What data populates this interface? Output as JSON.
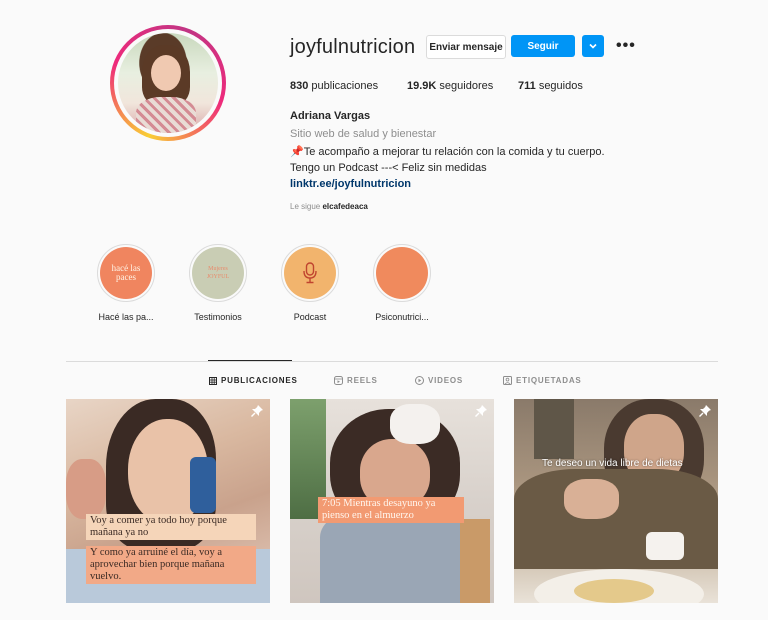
{
  "profile": {
    "username": "joyfulnutricion",
    "message_button": "Enviar mensaje",
    "follow_button": "Seguir",
    "stats": {
      "posts_count": "830",
      "posts_label": "publicaciones",
      "followers_count": "19.9K",
      "followers_label": "seguidores",
      "following_count": "711",
      "following_label": "seguidos"
    },
    "full_name": "Adriana Vargas",
    "category": "Sitio web de salud y bienestar",
    "bio_line1": "📌Te acompaño a mejorar tu relación con la comida y tu cuerpo.",
    "bio_line2": "Tengo un Podcast ---< Feliz sin medidas",
    "link": "linktr.ee/joyfulnutricion",
    "followed_by_prefix": "Le sigue",
    "followed_by_user": "elcafedeaca"
  },
  "highlights": [
    {
      "label": "Hacé las pa...",
      "cover_text": "hacé las paces",
      "color": "#f0855f"
    },
    {
      "label": "Testimonios",
      "cover_text": "Mujeres JOYFUL",
      "color": "#c9cdb4"
    },
    {
      "label": "Podcast",
      "cover_text": "",
      "color": "#f2b46d"
    },
    {
      "label": "Psiconutrici...",
      "cover_text": "",
      "color": "#f08a5d"
    }
  ],
  "tabs": [
    {
      "label": "PUBLICACIONES",
      "icon": "grid-icon",
      "active": true
    },
    {
      "label": "REELS",
      "icon": "reels-icon",
      "active": false
    },
    {
      "label": "VIDEOS",
      "icon": "video-icon",
      "active": false
    },
    {
      "label": "ETIQUETADAS",
      "icon": "tagged-icon",
      "active": false
    }
  ],
  "posts": [
    {
      "caption_1": "Voy a comer ya todo hoy porque mañana ya no",
      "caption_2": "Y como ya arruiné el día, voy a aprovechar bien porque mañana vuelvo.",
      "pinned": true
    },
    {
      "caption_1": "7:05 Mientras desayuno ya pienso en el almuerzo",
      "pinned": true
    },
    {
      "caption_1": "Te deseo un vida libre de dietas",
      "pinned": true
    }
  ],
  "colors": {
    "accent_blue": "#0095f6",
    "link_blue": "#00376b",
    "caption_bg_light": "#f6d3bb",
    "caption_bg_orange": "#f29a72"
  }
}
